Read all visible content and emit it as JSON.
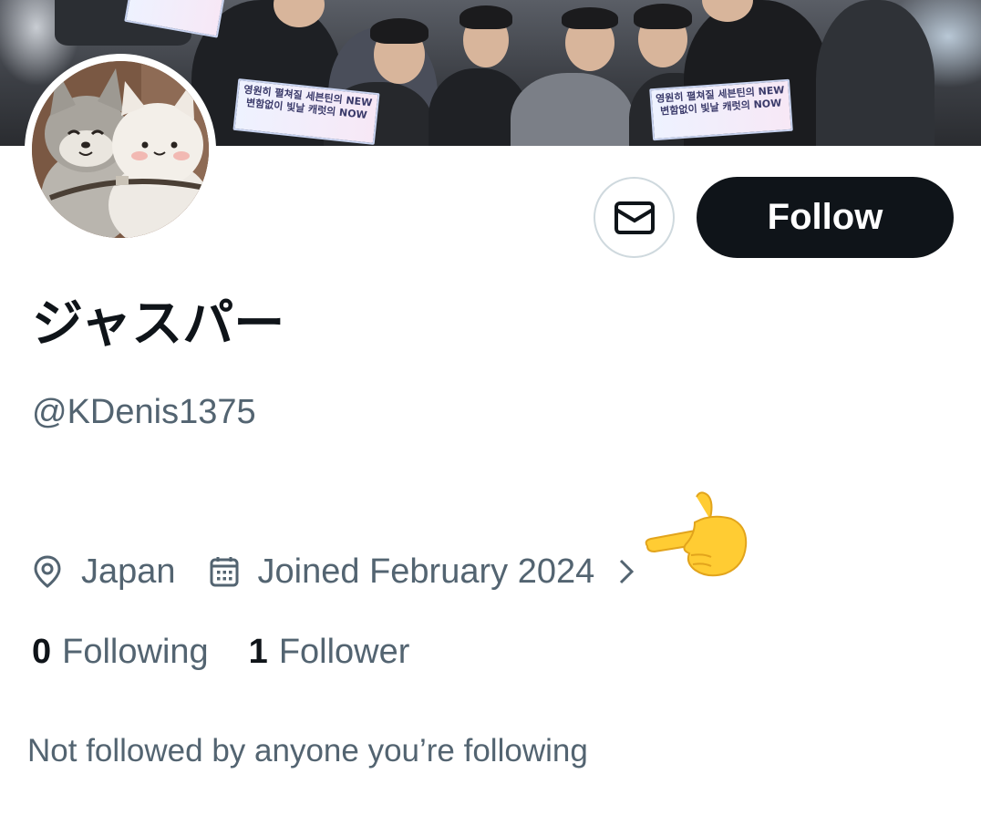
{
  "profile": {
    "display_name": "ジャスパー",
    "handle": "@KDenis1375",
    "location": "Japan",
    "joined": "Joined February 2024",
    "following_count": "0",
    "following_label": "Following",
    "followers_count": "1",
    "followers_label": "Follower",
    "followed_by_text": "Not followed by anyone you’re following"
  },
  "actions": {
    "message_icon": "envelope-icon",
    "follow_label": "Follow"
  },
  "banner": {
    "sign_text_line1": "영원히 펼쳐질 세븐틴의 NEW",
    "sign_text_line2": "변함없이 빛날 캐럿의 NOW"
  },
  "icons": {
    "location": "location-pin-icon",
    "calendar": "calendar-icon",
    "chevron": "chevron-right-icon",
    "pointer": "pointing-hand-emoji"
  },
  "colors": {
    "primary_text": "#0f1419",
    "secondary_text": "#536471",
    "follow_button_bg": "#0f1419",
    "border": "#cfd9de"
  }
}
